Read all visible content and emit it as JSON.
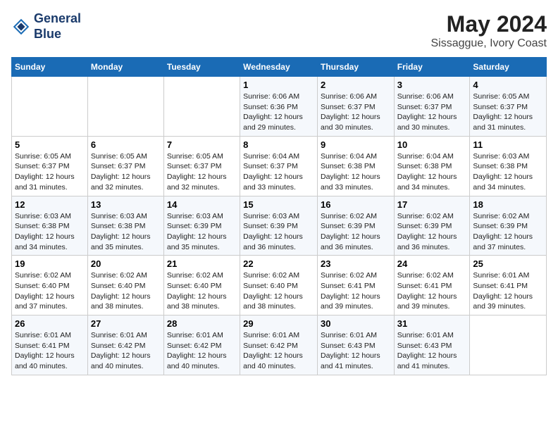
{
  "header": {
    "logo_line1": "General",
    "logo_line2": "Blue",
    "title": "May 2024",
    "subtitle": "Sissaggue, Ivory Coast"
  },
  "days_of_week": [
    "Sunday",
    "Monday",
    "Tuesday",
    "Wednesday",
    "Thursday",
    "Friday",
    "Saturday"
  ],
  "weeks": [
    [
      {
        "num": "",
        "info": ""
      },
      {
        "num": "",
        "info": ""
      },
      {
        "num": "",
        "info": ""
      },
      {
        "num": "1",
        "info": "Sunrise: 6:06 AM\nSunset: 6:36 PM\nDaylight: 12 hours and 29 minutes."
      },
      {
        "num": "2",
        "info": "Sunrise: 6:06 AM\nSunset: 6:37 PM\nDaylight: 12 hours and 30 minutes."
      },
      {
        "num": "3",
        "info": "Sunrise: 6:06 AM\nSunset: 6:37 PM\nDaylight: 12 hours and 30 minutes."
      },
      {
        "num": "4",
        "info": "Sunrise: 6:05 AM\nSunset: 6:37 PM\nDaylight: 12 hours and 31 minutes."
      }
    ],
    [
      {
        "num": "5",
        "info": "Sunrise: 6:05 AM\nSunset: 6:37 PM\nDaylight: 12 hours and 31 minutes."
      },
      {
        "num": "6",
        "info": "Sunrise: 6:05 AM\nSunset: 6:37 PM\nDaylight: 12 hours and 32 minutes."
      },
      {
        "num": "7",
        "info": "Sunrise: 6:05 AM\nSunset: 6:37 PM\nDaylight: 12 hours and 32 minutes."
      },
      {
        "num": "8",
        "info": "Sunrise: 6:04 AM\nSunset: 6:37 PM\nDaylight: 12 hours and 33 minutes."
      },
      {
        "num": "9",
        "info": "Sunrise: 6:04 AM\nSunset: 6:38 PM\nDaylight: 12 hours and 33 minutes."
      },
      {
        "num": "10",
        "info": "Sunrise: 6:04 AM\nSunset: 6:38 PM\nDaylight: 12 hours and 34 minutes."
      },
      {
        "num": "11",
        "info": "Sunrise: 6:03 AM\nSunset: 6:38 PM\nDaylight: 12 hours and 34 minutes."
      }
    ],
    [
      {
        "num": "12",
        "info": "Sunrise: 6:03 AM\nSunset: 6:38 PM\nDaylight: 12 hours and 34 minutes."
      },
      {
        "num": "13",
        "info": "Sunrise: 6:03 AM\nSunset: 6:38 PM\nDaylight: 12 hours and 35 minutes."
      },
      {
        "num": "14",
        "info": "Sunrise: 6:03 AM\nSunset: 6:39 PM\nDaylight: 12 hours and 35 minutes."
      },
      {
        "num": "15",
        "info": "Sunrise: 6:03 AM\nSunset: 6:39 PM\nDaylight: 12 hours and 36 minutes."
      },
      {
        "num": "16",
        "info": "Sunrise: 6:02 AM\nSunset: 6:39 PM\nDaylight: 12 hours and 36 minutes."
      },
      {
        "num": "17",
        "info": "Sunrise: 6:02 AM\nSunset: 6:39 PM\nDaylight: 12 hours and 36 minutes."
      },
      {
        "num": "18",
        "info": "Sunrise: 6:02 AM\nSunset: 6:39 PM\nDaylight: 12 hours and 37 minutes."
      }
    ],
    [
      {
        "num": "19",
        "info": "Sunrise: 6:02 AM\nSunset: 6:40 PM\nDaylight: 12 hours and 37 minutes."
      },
      {
        "num": "20",
        "info": "Sunrise: 6:02 AM\nSunset: 6:40 PM\nDaylight: 12 hours and 38 minutes."
      },
      {
        "num": "21",
        "info": "Sunrise: 6:02 AM\nSunset: 6:40 PM\nDaylight: 12 hours and 38 minutes."
      },
      {
        "num": "22",
        "info": "Sunrise: 6:02 AM\nSunset: 6:40 PM\nDaylight: 12 hours and 38 minutes."
      },
      {
        "num": "23",
        "info": "Sunrise: 6:02 AM\nSunset: 6:41 PM\nDaylight: 12 hours and 39 minutes."
      },
      {
        "num": "24",
        "info": "Sunrise: 6:02 AM\nSunset: 6:41 PM\nDaylight: 12 hours and 39 minutes."
      },
      {
        "num": "25",
        "info": "Sunrise: 6:01 AM\nSunset: 6:41 PM\nDaylight: 12 hours and 39 minutes."
      }
    ],
    [
      {
        "num": "26",
        "info": "Sunrise: 6:01 AM\nSunset: 6:41 PM\nDaylight: 12 hours and 40 minutes."
      },
      {
        "num": "27",
        "info": "Sunrise: 6:01 AM\nSunset: 6:42 PM\nDaylight: 12 hours and 40 minutes."
      },
      {
        "num": "28",
        "info": "Sunrise: 6:01 AM\nSunset: 6:42 PM\nDaylight: 12 hours and 40 minutes."
      },
      {
        "num": "29",
        "info": "Sunrise: 6:01 AM\nSunset: 6:42 PM\nDaylight: 12 hours and 40 minutes."
      },
      {
        "num": "30",
        "info": "Sunrise: 6:01 AM\nSunset: 6:43 PM\nDaylight: 12 hours and 41 minutes."
      },
      {
        "num": "31",
        "info": "Sunrise: 6:01 AM\nSunset: 6:43 PM\nDaylight: 12 hours and 41 minutes."
      },
      {
        "num": "",
        "info": ""
      }
    ]
  ]
}
